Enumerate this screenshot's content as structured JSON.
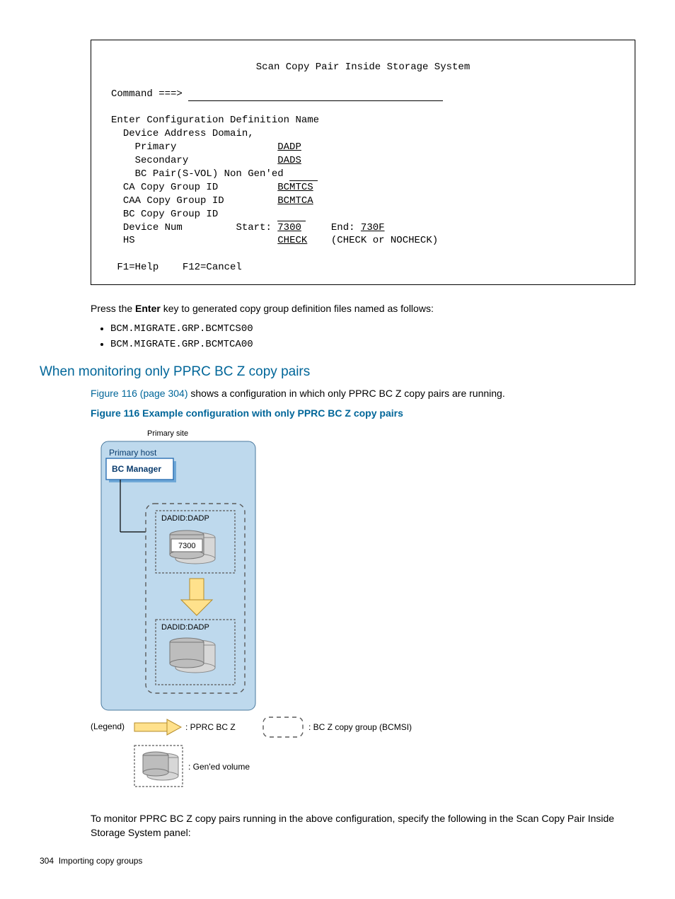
{
  "panel": {
    "title": "Scan Copy Pair Inside Storage System",
    "command_label": "Command ===>",
    "enter_cfg": "Enter Configuration Definition Name",
    "dev_addr_domain": "Device Address Domain,",
    "primary_label": "Primary",
    "primary_val": "DADP",
    "secondary_label": "Secondary",
    "secondary_val": "DADS",
    "bcpair": "BC Pair(S-VOL) Non Gen'ed",
    "ca_label": "CA Copy Group ID",
    "ca_val": "BCMTCS",
    "caa_label": "CAA Copy Group ID",
    "caa_val": "BCMTCA",
    "bc_label": "BC Copy Group ID",
    "devnum_label": "Device Num",
    "start_label": "Start:",
    "start_val": "7300",
    "end_label": "End:",
    "end_val": "730F",
    "hs_label": "HS",
    "hs_val": "CHECK",
    "hs_hint": "(CHECK or NOCHECK)",
    "fkeys": "F1=Help    F12=Cancel"
  },
  "intro_para_a": "Press the ",
  "intro_para_bold": "Enter",
  "intro_para_b": " key to generated copy group definition files named as follows:",
  "files": [
    "BCM.MIGRATE.GRP.BCMTCS00",
    "BCM.MIGRATE.GRP.BCMTCA00"
  ],
  "section_heading": "When monitoring only PPRC BC Z copy pairs",
  "fig_ref": "Figure 116 (page 304)",
  "fig_ref_after": " shows a configuration in which only PPRC BC Z copy pairs are running.",
  "fig_caption": "Figure 116 Example configuration with only PPRC BC Z copy pairs",
  "diagram": {
    "primary_site": "Primary site",
    "primary_host": "Primary host",
    "bc_manager": "BC Manager",
    "dadid_top": "DADID:DADP",
    "vol_num": "7300",
    "dadid_bot": "DADID:DADP",
    "legend": "(Legend)",
    "lg_pprc": ": PPRC BC Z",
    "lg_bcz": ": BC Z copy group (BCMSI)",
    "lg_gen": ": Gen'ed volume"
  },
  "closing_para": "To monitor PPRC BC Z copy pairs running in the above configuration, specify the following in the Scan Copy Pair Inside Storage System panel:",
  "pagefoot_num": "304",
  "pagefoot_text": "Importing copy groups"
}
